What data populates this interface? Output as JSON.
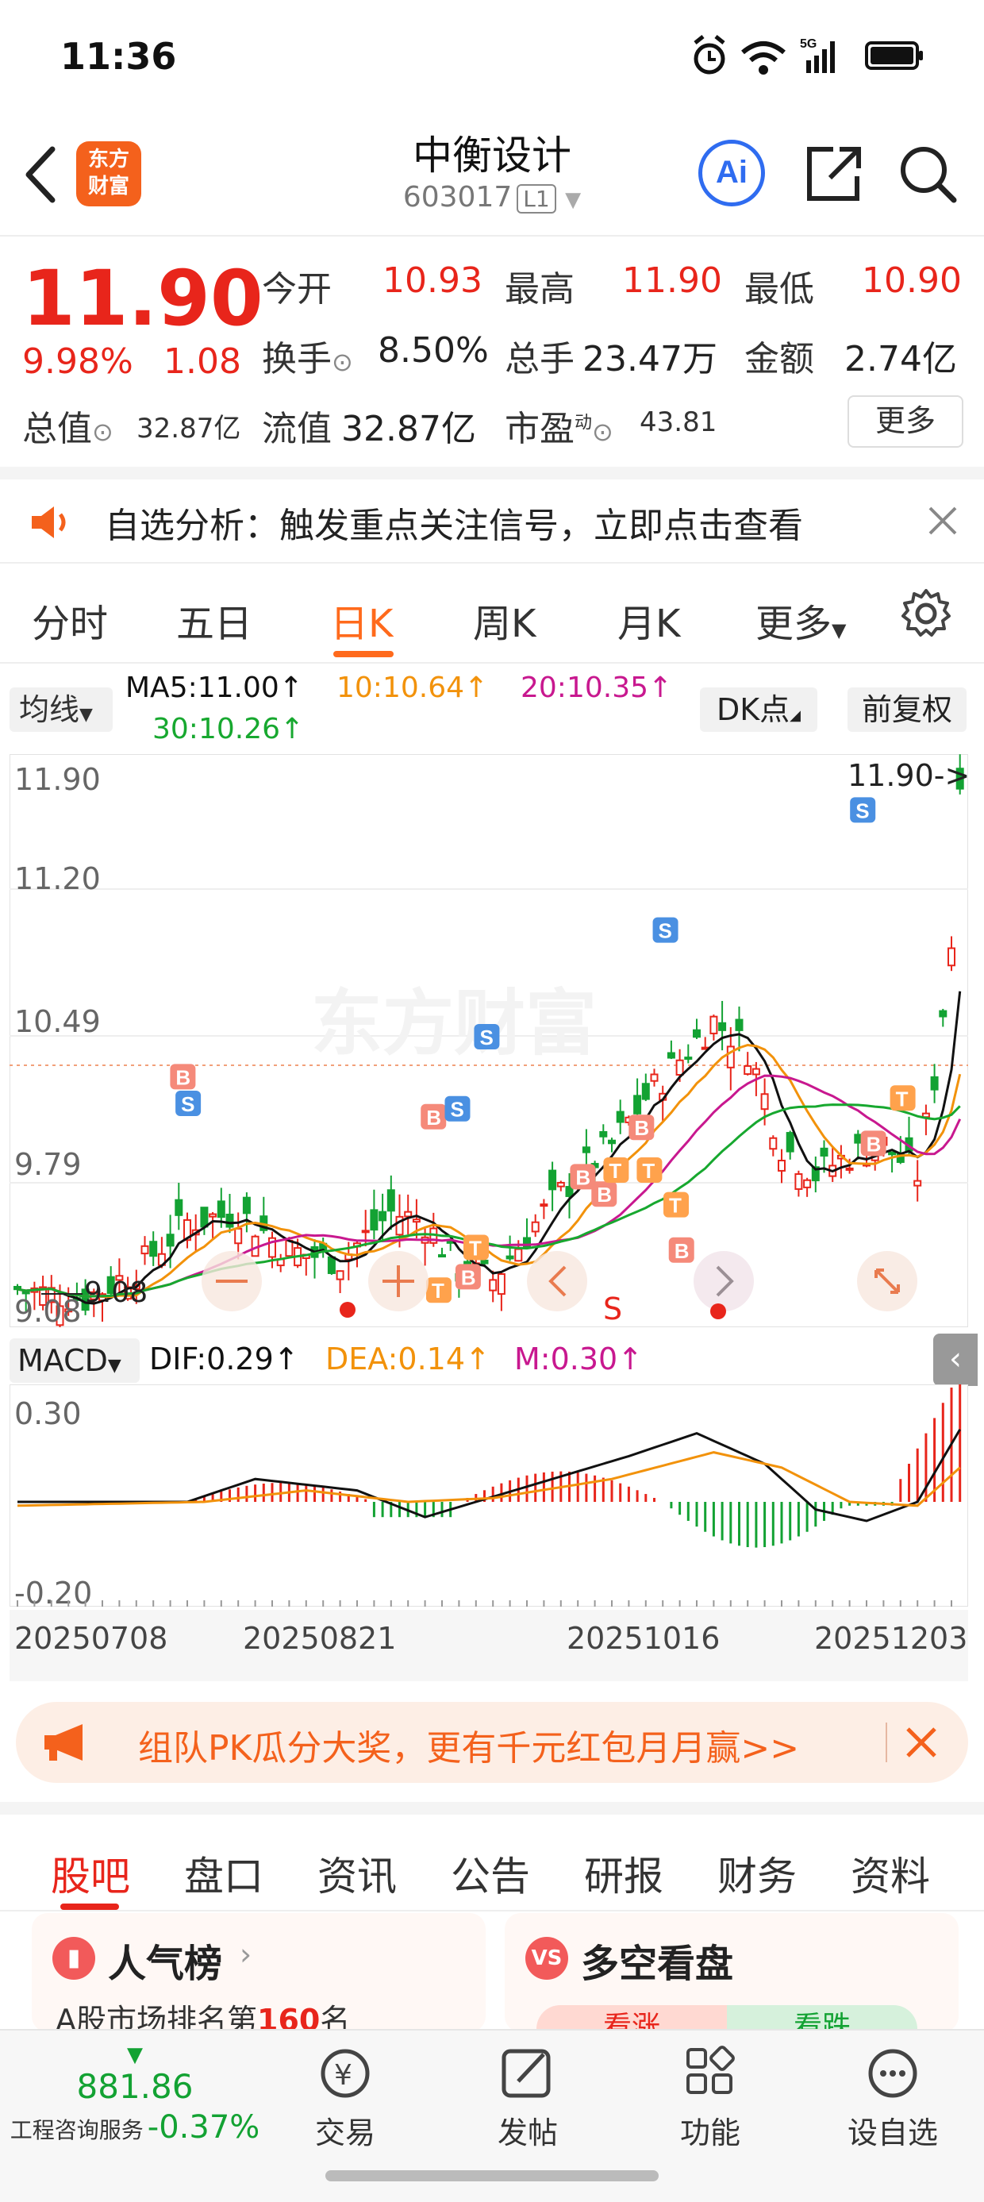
{
  "status_bar": {
    "time": "11:36",
    "network": "5G"
  },
  "header": {
    "stock_name": "中衡设计",
    "stock_code": "603017",
    "level_badge": "L1",
    "logo_line1": "东方",
    "logo_line2": "财富",
    "ai_label": "Ai"
  },
  "quote": {
    "price": "11.90",
    "change_pct": "9.98%",
    "change_amt": "1.08",
    "open_label": "今开",
    "open": "10.93",
    "high_label": "最高",
    "high": "11.90",
    "low_label": "最低",
    "low": "10.90",
    "turnover_label": "换手",
    "turnover": "8.50%",
    "volume_label": "总手",
    "volume": "23.47万",
    "amount_label": "金额",
    "amount": "2.74亿",
    "mktcap_label": "总值",
    "mktcap": "32.87亿",
    "float_label": "流值",
    "float_cap": "32.87亿",
    "pe_label": "市盈",
    "pe_sup": "动",
    "pe": "43.81",
    "more_button": "更多"
  },
  "notice": {
    "text": "自选分析：触发重点关注信号，立即点击查看"
  },
  "period_tabs": [
    "分时",
    "五日",
    "日K",
    "周K",
    "月K",
    "更多"
  ],
  "active_period": "日K",
  "ma": {
    "selector": "均线",
    "ma5": "MA5:11.00↑",
    "ma10": "10:10.64↑",
    "ma20": "20:10.35↑",
    "ma30": "30:10.26↑",
    "dk_button": "DK点",
    "adjust_button": "前复权"
  },
  "kline": {
    "y_labels": [
      "11.90",
      "11.20",
      "10.49",
      "9.79",
      "9.08"
    ],
    "last_price_label": "11.90->",
    "low_label": "9.08",
    "watermark": "东方财富",
    "marker_s": "S"
  },
  "macd": {
    "selector": "MACD",
    "dif": "DIF:0.29↑",
    "dea": "DEA:0.14↑",
    "m": "M:0.30↑",
    "y_top": "0.30",
    "y_bottom": "-0.20"
  },
  "dates": [
    "20250708",
    "20250821",
    "20251016",
    "20251203"
  ],
  "banner": {
    "text": "组队PK瓜分大奖，更有千元红包月月赢>>"
  },
  "sub_tabs": [
    "股吧",
    "盘口",
    "资讯",
    "公告",
    "研报",
    "财务",
    "资料"
  ],
  "active_sub_tab": "股吧",
  "cards": {
    "popularity_title": "人气榜",
    "popularity_sub": "A股市场排名第",
    "popularity_rank": "160",
    "popularity_suffix": "名",
    "sentiment_title": "多空看盘",
    "bull": "看涨",
    "bear": "看跌"
  },
  "bottom_nav": {
    "index_value": "881.86",
    "index_name": "工程咨询服务",
    "index_change": "-0.37%",
    "items": [
      "交易",
      "发帖",
      "功能",
      "设自选"
    ]
  },
  "colors": {
    "up": "#e8251b",
    "down": "#13a233",
    "accent": "#ff6a1c",
    "ma5": "#111111",
    "ma10": "#f2920b",
    "ma20": "#c8188f",
    "ma30": "#17a82f"
  }
}
